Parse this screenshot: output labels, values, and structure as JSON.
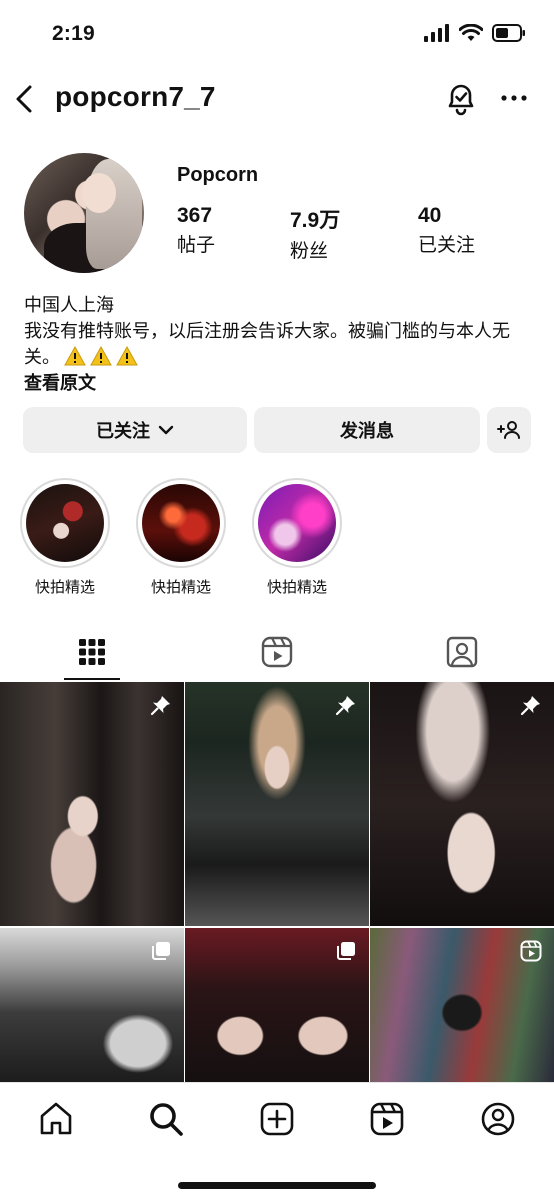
{
  "status_bar": {
    "time": "2:19"
  },
  "header": {
    "username": "popcorn7_7"
  },
  "profile": {
    "display_name": "Popcorn",
    "stats": [
      {
        "value": "367",
        "label": "帖子"
      },
      {
        "value": "7.9万",
        "label": "粉丝"
      },
      {
        "value": "40",
        "label": "已关注"
      }
    ],
    "bio_line1": "中国人上海",
    "bio_line2": " 我没有推特账号，以后注册会告诉大家。被骗门槛的与本人无关。",
    "see_original": "查看原文"
  },
  "actions": {
    "following_label": "已关注",
    "message_label": "发消息"
  },
  "highlights": [
    {
      "label": "快拍精选"
    },
    {
      "label": "快拍精选"
    },
    {
      "label": "快拍精选"
    }
  ],
  "tabs": [
    "posts-grid",
    "reels",
    "tagged"
  ],
  "colors": {
    "accent": "#111111",
    "button_bg": "#efefef",
    "warning": "#f2c21b"
  }
}
